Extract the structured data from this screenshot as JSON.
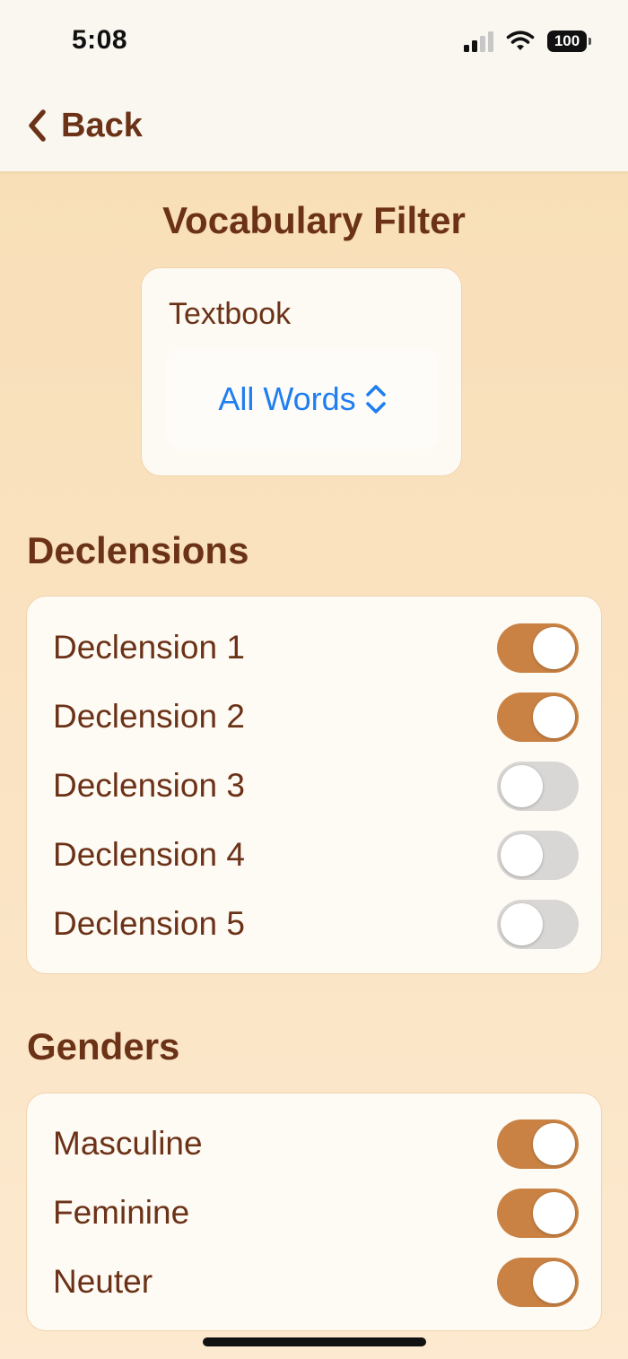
{
  "status_bar": {
    "time": "5:08",
    "battery": "100"
  },
  "nav": {
    "back_label": "Back"
  },
  "page": {
    "title": "Vocabulary Filter"
  },
  "textbook": {
    "label": "Textbook",
    "selected": "All Words"
  },
  "declensions": {
    "heading": "Declensions",
    "items": [
      {
        "label": "Declension 1",
        "on": true
      },
      {
        "label": "Declension 2",
        "on": true
      },
      {
        "label": "Declension 3",
        "on": false
      },
      {
        "label": "Declension 4",
        "on": false
      },
      {
        "label": "Declension 5",
        "on": false
      }
    ]
  },
  "genders": {
    "heading": "Genders",
    "items": [
      {
        "label": "Masculine",
        "on": true
      },
      {
        "label": "Feminine",
        "on": true
      },
      {
        "label": "Neuter",
        "on": true
      }
    ]
  },
  "colors": {
    "accent": "#c98243",
    "text": "#6b3217",
    "link": "#1f7ef0",
    "toggle_off": "#d9d7d5"
  },
  "icons": [
    "chevron-left-icon",
    "chevron-up-down-icon",
    "cellular-signal-icon",
    "wifi-icon",
    "battery-icon"
  ]
}
